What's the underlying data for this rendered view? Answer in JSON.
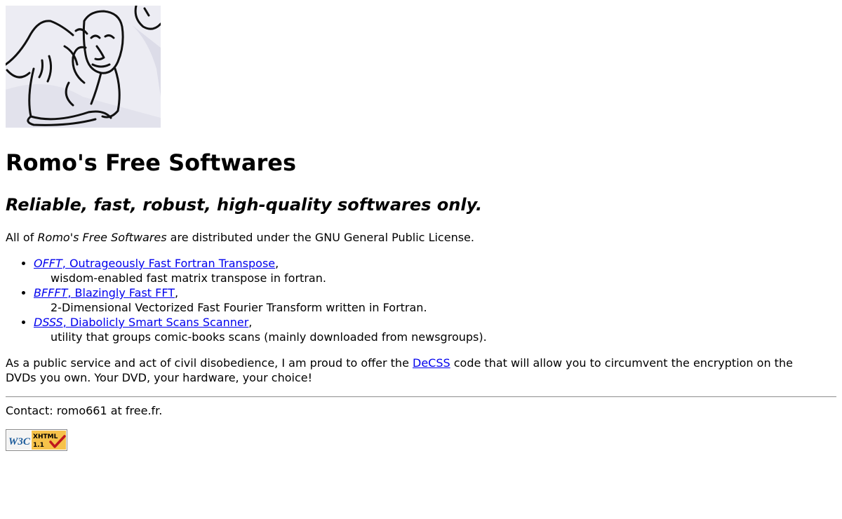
{
  "header": {
    "title": "Romo's Free Softwares",
    "tagline": "Reliable, fast, robust, high-quality softwares only."
  },
  "intro": {
    "prefix": "All of ",
    "name": "Romo's Free Softwares",
    "suffix": " are distributed under the GNU General Public License."
  },
  "softwares": [
    {
      "abbr": "OFFT",
      "name": ", Outrageously Fast Fortran Transpose",
      "description": "wisdom-enabled fast matrix transpose in fortran."
    },
    {
      "abbr": "BFFFT",
      "name": ", Blazingly Fast FFT",
      "description": "2-Dimensional Vectorized Fast Fourier Transform written in Fortran."
    },
    {
      "abbr": "DSSS",
      "name": ", Diabolicly Smart Scans Scanner",
      "description": "utility that groups comic-books scans (mainly downloaded from newsgroups)."
    }
  ],
  "civil": {
    "before": "As a public service and act of civil disobedience, I am proud to offer the ",
    "link": "DeCSS",
    "after": " code that will allow you to circumvent the encryption on the DVDs you own. Your DVD, your hardware, your choice!"
  },
  "contact": "Contact: romo661 at free.fr.",
  "badge": {
    "w3c": "W3C",
    "label": "XHTML",
    "version": "1.1"
  }
}
